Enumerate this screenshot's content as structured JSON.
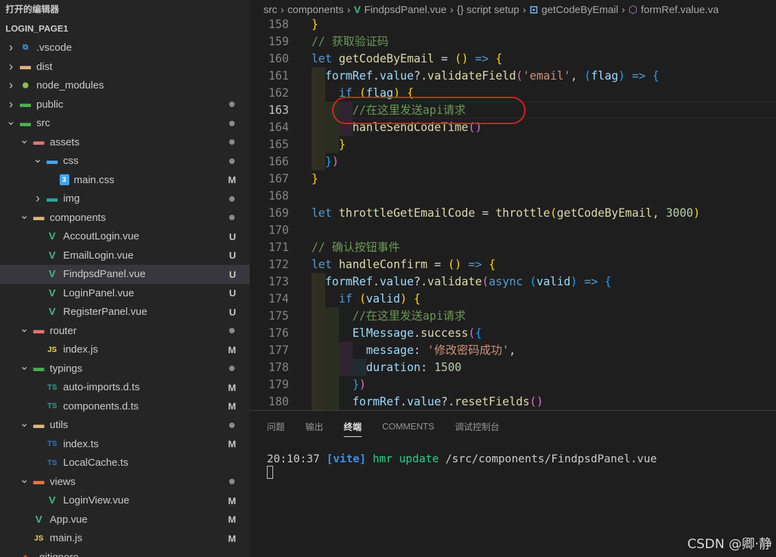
{
  "sidebar": {
    "open_editors_label": "打开的编辑器",
    "project_label": "LOGIN_PAGE1",
    "items": [
      {
        "label": ".vscode",
        "icon": "vscode-folder-icon",
        "depth": 0,
        "chev": "right",
        "status": ""
      },
      {
        "label": "dist",
        "icon": "folder-icon",
        "depth": 0,
        "chev": "right",
        "status": ""
      },
      {
        "label": "node_modules",
        "icon": "node-folder-icon",
        "depth": 0,
        "chev": "right",
        "status": ""
      },
      {
        "label": "public",
        "icon": "public-folder-icon",
        "depth": 0,
        "chev": "right",
        "status": "dot"
      },
      {
        "label": "src",
        "icon": "src-folder-icon",
        "depth": 0,
        "chev": "down",
        "status": "dot"
      },
      {
        "label": "assets",
        "icon": "assets-folder-icon",
        "depth": 1,
        "chev": "down",
        "status": "dot"
      },
      {
        "label": "css",
        "icon": "css-folder-icon",
        "depth": 2,
        "chev": "down",
        "status": "dot"
      },
      {
        "label": "main.css",
        "icon": "css-file-icon",
        "depth": 3,
        "chev": "",
        "status": "M"
      },
      {
        "label": "img",
        "icon": "img-folder-icon",
        "depth": 2,
        "chev": "right",
        "status": "dot"
      },
      {
        "label": "components",
        "icon": "components-folder-icon",
        "depth": 1,
        "chev": "down",
        "status": "dot"
      },
      {
        "label": "AccoutLogin.vue",
        "icon": "vue-file-icon",
        "depth": 2,
        "chev": "",
        "status": "U"
      },
      {
        "label": "EmailLogin.vue",
        "icon": "vue-file-icon",
        "depth": 2,
        "chev": "",
        "status": "U"
      },
      {
        "label": "FindpsdPanel.vue",
        "icon": "vue-file-icon",
        "depth": 2,
        "chev": "",
        "status": "U",
        "selected": true
      },
      {
        "label": "LoginPanel.vue",
        "icon": "vue-file-icon",
        "depth": 2,
        "chev": "",
        "status": "U"
      },
      {
        "label": "RegisterPanel.vue",
        "icon": "vue-file-icon",
        "depth": 2,
        "chev": "",
        "status": "U"
      },
      {
        "label": "router",
        "icon": "router-folder-icon",
        "depth": 1,
        "chev": "down",
        "status": "dot"
      },
      {
        "label": "index.js",
        "icon": "js-file-icon",
        "depth": 2,
        "chev": "",
        "status": "M"
      },
      {
        "label": "typings",
        "icon": "typings-folder-icon",
        "depth": 1,
        "chev": "down",
        "status": "dot"
      },
      {
        "label": "auto-imports.d.ts",
        "icon": "dts-file-icon",
        "depth": 2,
        "chev": "",
        "status": "M"
      },
      {
        "label": "components.d.ts",
        "icon": "dts-file-icon",
        "depth": 2,
        "chev": "",
        "status": "M"
      },
      {
        "label": "utils",
        "icon": "utils-folder-icon",
        "depth": 1,
        "chev": "down",
        "status": "dot"
      },
      {
        "label": "index.ts",
        "icon": "ts-file-icon",
        "depth": 2,
        "chev": "",
        "status": "M"
      },
      {
        "label": "LocalCache.ts",
        "icon": "ts-file-icon",
        "depth": 2,
        "chev": "",
        "status": ""
      },
      {
        "label": "views",
        "icon": "views-folder-icon",
        "depth": 1,
        "chev": "down",
        "status": "dot"
      },
      {
        "label": "LoginView.vue",
        "icon": "vue-file-icon",
        "depth": 2,
        "chev": "",
        "status": "M"
      },
      {
        "label": "App.vue",
        "icon": "vue-file-icon",
        "depth": 1,
        "chev": "",
        "status": "M"
      },
      {
        "label": "main.js",
        "icon": "js-file-icon",
        "depth": 1,
        "chev": "",
        "status": "M"
      },
      {
        "label": ".gitignore",
        "icon": "git-file-icon",
        "depth": 0,
        "chev": "",
        "status": ""
      }
    ]
  },
  "breadcrumb": {
    "items": [
      "src",
      "components",
      "FindpsdPanel.vue",
      "{} script setup",
      "getCodeByEmail",
      "formRef.value.va"
    ]
  },
  "code": {
    "active_line": 163,
    "lines": [
      {
        "n": 158,
        "tokens": [
          [
            "br1",
            "}"
          ]
        ]
      },
      {
        "n": 159,
        "tokens": [
          [
            "cm",
            "// 获取验证码"
          ]
        ]
      },
      {
        "n": 160,
        "tokens": [
          [
            "kw",
            "let "
          ],
          [
            "fn",
            "getCodeByEmail"
          ],
          [
            "pl",
            " = "
          ],
          [
            "br1",
            "("
          ],
          [
            "br1",
            ")"
          ],
          [
            "kw",
            " => "
          ],
          [
            "br1",
            "{"
          ]
        ]
      },
      {
        "n": 161,
        "tokens": [
          [
            "pl",
            "  "
          ],
          [
            "var",
            "formRef"
          ],
          [
            "pl",
            "."
          ],
          [
            "var",
            "value"
          ],
          [
            "pl",
            "?."
          ],
          [
            "fn",
            "validateField"
          ],
          [
            "br2",
            "("
          ],
          [
            "str",
            "'email'"
          ],
          [
            "pl",
            ", "
          ],
          [
            "br3",
            "("
          ],
          [
            "var",
            "flag"
          ],
          [
            "br3",
            ")"
          ],
          [
            "kw",
            " => "
          ],
          [
            "br3",
            "{"
          ]
        ]
      },
      {
        "n": 162,
        "tokens": [
          [
            "pl",
            "    "
          ],
          [
            "kw",
            "if "
          ],
          [
            "br1",
            "("
          ],
          [
            "var",
            "flag"
          ],
          [
            "br1",
            ")"
          ],
          [
            "pl",
            " "
          ],
          [
            "br1",
            "{"
          ]
        ]
      },
      {
        "n": 163,
        "tokens": [
          [
            "pl",
            "      "
          ],
          [
            "cm",
            "//在这里发送api请求"
          ]
        ]
      },
      {
        "n": 164,
        "tokens": [
          [
            "pl",
            "      "
          ],
          [
            "fn",
            "hanleSendCodeTime"
          ],
          [
            "br2",
            "("
          ],
          [
            "br2",
            ")"
          ]
        ]
      },
      {
        "n": 165,
        "tokens": [
          [
            "pl",
            "    "
          ],
          [
            "br1",
            "}"
          ]
        ]
      },
      {
        "n": 166,
        "tokens": [
          [
            "pl",
            "  "
          ],
          [
            "br3",
            "}"
          ],
          [
            "br2",
            ")"
          ]
        ]
      },
      {
        "n": 167,
        "tokens": [
          [
            "br1",
            "}"
          ]
        ]
      },
      {
        "n": 168,
        "tokens": []
      },
      {
        "n": 169,
        "tokens": [
          [
            "kw",
            "let "
          ],
          [
            "fn",
            "throttleGetEmailCode"
          ],
          [
            "pl",
            " = "
          ],
          [
            "fn",
            "throttle"
          ],
          [
            "br1",
            "("
          ],
          [
            "fn",
            "getCodeByEmail"
          ],
          [
            "pl",
            ", "
          ],
          [
            "num",
            "3000"
          ],
          [
            "br1",
            ")"
          ]
        ]
      },
      {
        "n": 170,
        "tokens": []
      },
      {
        "n": 171,
        "tokens": [
          [
            "cm",
            "// 确认按钮事件"
          ]
        ]
      },
      {
        "n": 172,
        "tokens": [
          [
            "kw",
            "let "
          ],
          [
            "fn",
            "handleConfirm"
          ],
          [
            "pl",
            " = "
          ],
          [
            "br1",
            "("
          ],
          [
            "br1",
            ")"
          ],
          [
            "kw",
            " => "
          ],
          [
            "br1",
            "{"
          ]
        ]
      },
      {
        "n": 173,
        "tokens": [
          [
            "pl",
            "  "
          ],
          [
            "var",
            "formRef"
          ],
          [
            "pl",
            "."
          ],
          [
            "var",
            "value"
          ],
          [
            "pl",
            "?."
          ],
          [
            "fn",
            "validate"
          ],
          [
            "br2",
            "("
          ],
          [
            "kw",
            "async "
          ],
          [
            "br3",
            "("
          ],
          [
            "var",
            "valid"
          ],
          [
            "br3",
            ")"
          ],
          [
            "kw",
            " => "
          ],
          [
            "br3",
            "{"
          ]
        ]
      },
      {
        "n": 174,
        "tokens": [
          [
            "pl",
            "    "
          ],
          [
            "kw",
            "if "
          ],
          [
            "br1",
            "("
          ],
          [
            "var",
            "valid"
          ],
          [
            "br1",
            ")"
          ],
          [
            "pl",
            " "
          ],
          [
            "br1",
            "{"
          ]
        ]
      },
      {
        "n": 175,
        "tokens": [
          [
            "pl",
            "      "
          ],
          [
            "cm",
            "//在这里发送api请求"
          ]
        ]
      },
      {
        "n": 176,
        "tokens": [
          [
            "pl",
            "      "
          ],
          [
            "var",
            "ElMessage"
          ],
          [
            "pl",
            "."
          ],
          [
            "fn",
            "success"
          ],
          [
            "br2",
            "("
          ],
          [
            "br3",
            "{"
          ]
        ]
      },
      {
        "n": 177,
        "tokens": [
          [
            "pl",
            "        "
          ],
          [
            "var",
            "message"
          ],
          [
            "pl",
            ": "
          ],
          [
            "str",
            "'修改密码成功'"
          ],
          [
            "pl",
            ","
          ]
        ]
      },
      {
        "n": 178,
        "tokens": [
          [
            "pl",
            "        "
          ],
          [
            "var",
            "duration"
          ],
          [
            "pl",
            ": "
          ],
          [
            "num",
            "1500"
          ]
        ]
      },
      {
        "n": 179,
        "tokens": [
          [
            "pl",
            "      "
          ],
          [
            "br3",
            "}"
          ],
          [
            "br2",
            ")"
          ]
        ]
      },
      {
        "n": 180,
        "tokens": [
          [
            "pl",
            "      "
          ],
          [
            "var",
            "formRef"
          ],
          [
            "pl",
            "."
          ],
          [
            "var",
            "value"
          ],
          [
            "pl",
            "?."
          ],
          [
            "fn",
            "resetFields"
          ],
          [
            "br2",
            "("
          ],
          [
            "br2",
            ")"
          ]
        ]
      }
    ]
  },
  "panel": {
    "tabs": [
      "问题",
      "输出",
      "终端",
      "COMMENTS",
      "调试控制台"
    ],
    "active_tab": "终端",
    "terminal": {
      "time": "20:10:37",
      "tag": "[vite]",
      "msg": "hmr update",
      "path": "/src/components/FindpsdPanel.vue"
    }
  },
  "watermark": "CSDN @卿·静",
  "colors": {
    "annotation_circle": "#e02020",
    "selection": "#37373d"
  }
}
